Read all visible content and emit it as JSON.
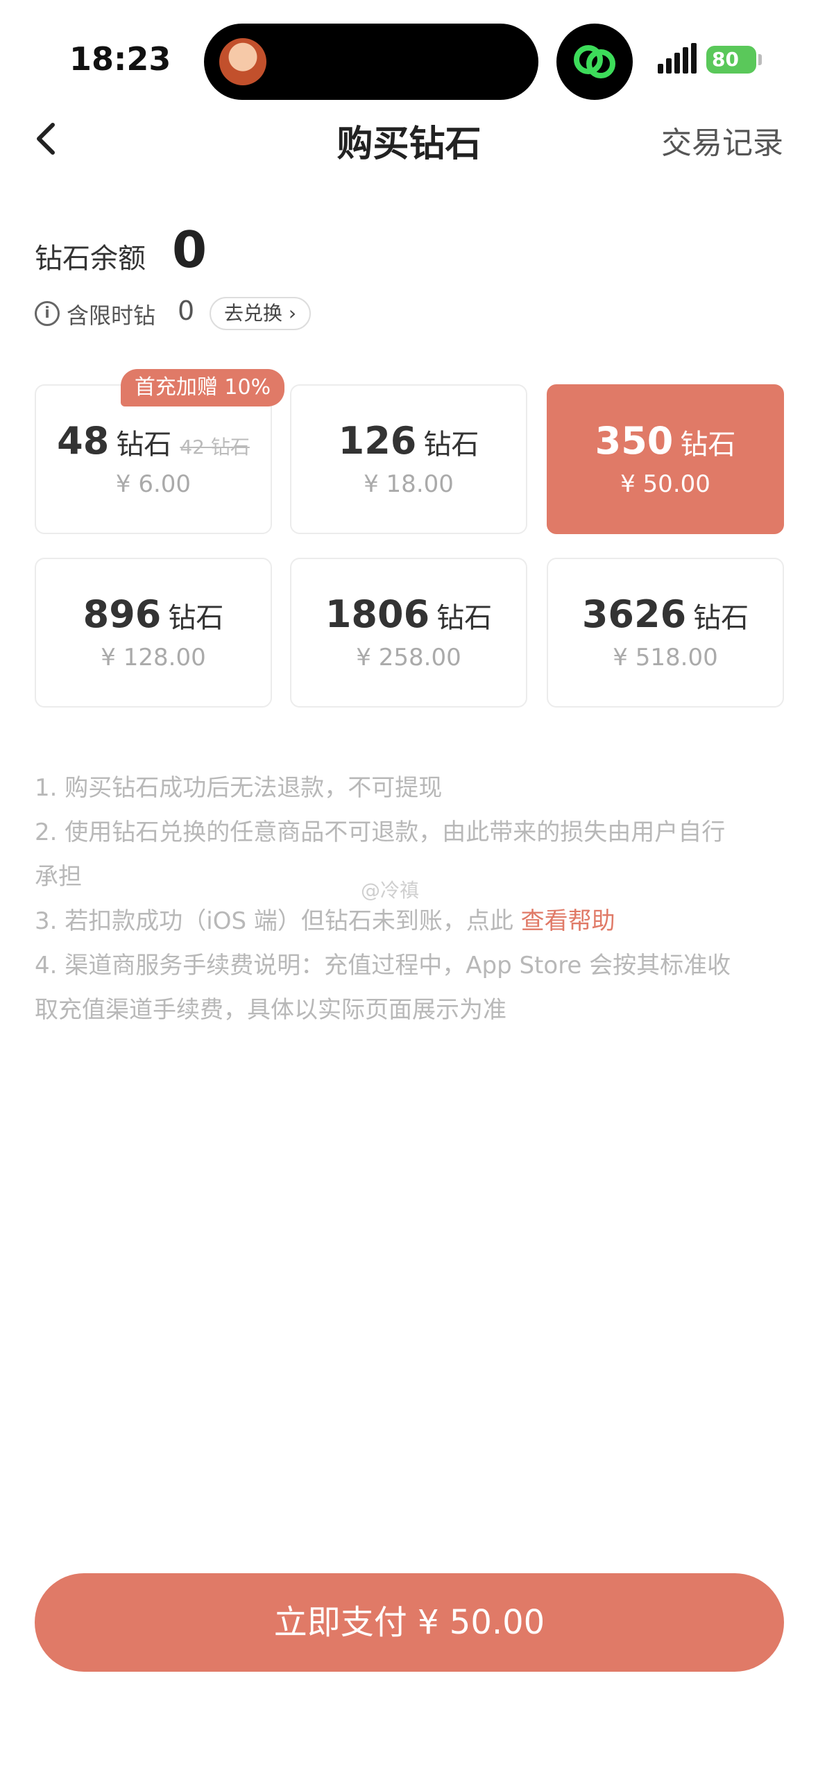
{
  "status_bar": {
    "time": "18:23",
    "battery": "80"
  },
  "nav": {
    "title": "购买钻石",
    "right_link": "交易记录"
  },
  "balance": {
    "label": "钻石余额",
    "value": "0",
    "limited_label": "含限时钻",
    "limited_value": "0",
    "exchange_button": "去兑换"
  },
  "packages": [
    {
      "amount": "48",
      "unit": "钻石",
      "original": "42 钻石",
      "price": "¥ 6.00",
      "badge": "首充加赠 10%"
    },
    {
      "amount": "126",
      "unit": "钻石",
      "price": "¥ 18.00"
    },
    {
      "amount": "350",
      "unit": "钻石",
      "price": "¥ 50.00",
      "selected": true
    },
    {
      "amount": "896",
      "unit": "钻石",
      "price": "¥ 128.00"
    },
    {
      "amount": "1806",
      "unit": "钻石",
      "price": "¥ 258.00"
    },
    {
      "amount": "3626",
      "unit": "钻石",
      "price": "¥ 518.00"
    }
  ],
  "notes": {
    "n1": "1. 购买钻石成功后无法退款，不可提现",
    "n2a": "2. 使用钻石兑换的任意商品不可退款，由此带来的损失由用户自行",
    "n2b": "承担",
    "n3_text": "3. 若扣款成功（iOS 端）但钻石未到账，点此 ",
    "n3_link": "查看帮助",
    "n4a": "4. 渠道商服务手续费说明：充值过程中，App Store 会按其标准收",
    "n4b": "取充值渠道手续费，具体以实际页面展示为准"
  },
  "watermark": "@冷禛",
  "pay_button": "立即支付 ¥ 50.00",
  "colors": {
    "accent": "#e07a67",
    "battery": "#5ac85a"
  }
}
